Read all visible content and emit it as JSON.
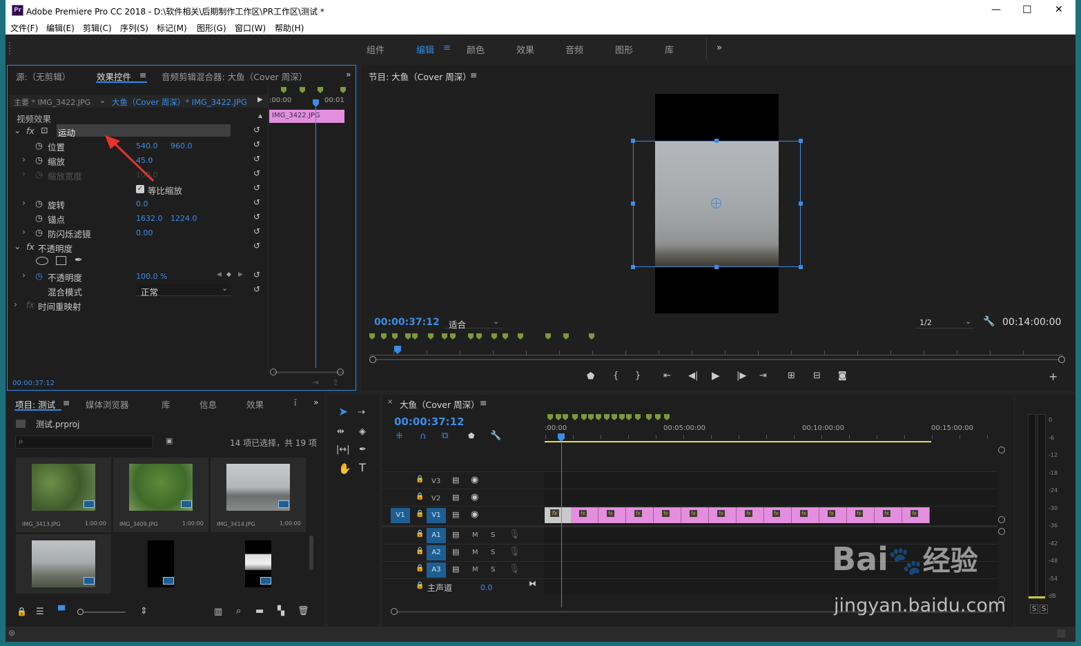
{
  "window": {
    "title": "Adobe Premiere Pro CC 2018 - D:\\软件相关\\后期制作工作区\\PR工作区\\测试 *",
    "app_icon": "Pr",
    "minimize": "—",
    "maximize": "☐",
    "close": "✕"
  },
  "menu": [
    "文件(F)",
    "编辑(E)",
    "剪辑(C)",
    "序列(S)",
    "标记(M)",
    "图形(G)",
    "窗口(W)",
    "帮助(H)"
  ],
  "workspaces": [
    "组件",
    "编辑",
    "颜色",
    "效果",
    "音频",
    "图形",
    "库"
  ],
  "workspace_active": "编辑",
  "workspace_more": "»",
  "effect_panel": {
    "tabs": [
      "源:（无剪辑）",
      "效果控件",
      "音频剪辑混合器: 大鱼（Cover 周深）"
    ],
    "active_tab": "效果控件",
    "master_clip": "主要 * IMG_3422.JPG",
    "seq_clip": "大鱼（Cover 周深）* IMG_3422.JPG",
    "section": "视频效果",
    "motion": "运动",
    "props": {
      "position": {
        "label": "位置",
        "x": "540.0",
        "y": "960.0"
      },
      "scale": {
        "label": "缩放",
        "v": "45.0"
      },
      "scale_width": {
        "label": "缩放宽度",
        "v": "100.0"
      },
      "uniform": {
        "label": "等比缩放",
        "checked": true
      },
      "rotation": {
        "label": "旋转",
        "v": "0.0"
      },
      "anchor": {
        "label": "锚点",
        "x": "1632.0",
        "y": "1224.0"
      },
      "antiflicker": {
        "label": "防闪烁滤镜",
        "v": "0.00"
      }
    },
    "opacity_group": "不透明度",
    "opacity": {
      "label": "不透明度",
      "v": "100.0 %"
    },
    "blend": {
      "label": "混合模式",
      "v": "正常"
    },
    "time_remap": "时间重映射",
    "mini_timeline": {
      "t0": ":00:00",
      "t1": "00:01",
      "clip": "IMG_3422.JPG"
    },
    "timecode": "00:00:37:12"
  },
  "program": {
    "title": "节目: 大鱼（Cover 周深）",
    "timecode": "00:00:37:12",
    "fit": "适合",
    "resolution": "1/2",
    "duration": "00:14:00:00"
  },
  "project": {
    "tabs": [
      "项目: 测试",
      "媒体浏览器",
      "库",
      "信息",
      "效果",
      "ī"
    ],
    "file": "测试.prproj",
    "selection": "14 项已选择，共 19 项",
    "items": [
      {
        "name": "IMG_3413.JPG",
        "dur": "1:00:00"
      },
      {
        "name": "IMG_3409.JPG",
        "dur": "1:00:00"
      },
      {
        "name": "IMG_3414.JPG",
        "dur": "1:00:00"
      },
      {
        "name": "",
        "dur": ""
      },
      {
        "name": "",
        "dur": ""
      },
      {
        "name": "",
        "dur": ""
      }
    ]
  },
  "timeline": {
    "title": "大鱼（Cover 周深）",
    "timecode": "00:00:37:12",
    "ruler": [
      ":00:00",
      "00:05:00:00",
      "00:10:00:00",
      "00:15:00:00"
    ],
    "video_tracks": [
      "V3",
      "V2",
      "V1"
    ],
    "audio_tracks": [
      "A1",
      "A2",
      "A3"
    ],
    "source_v": "V1",
    "master": {
      "label": "主声道",
      "v": "0.0"
    },
    "mute": "M",
    "solo": "S"
  },
  "meter": {
    "ticks": [
      "0",
      "-6",
      "-12",
      "-18",
      "-24",
      "-30",
      "-36",
      "-42",
      "-48",
      "-54",
      "dB"
    ],
    "buttons": [
      "S",
      "S"
    ]
  },
  "watermark": {
    "brand": "Bai",
    "brand2": "经验",
    "url": "jingyan.baidu.com"
  }
}
